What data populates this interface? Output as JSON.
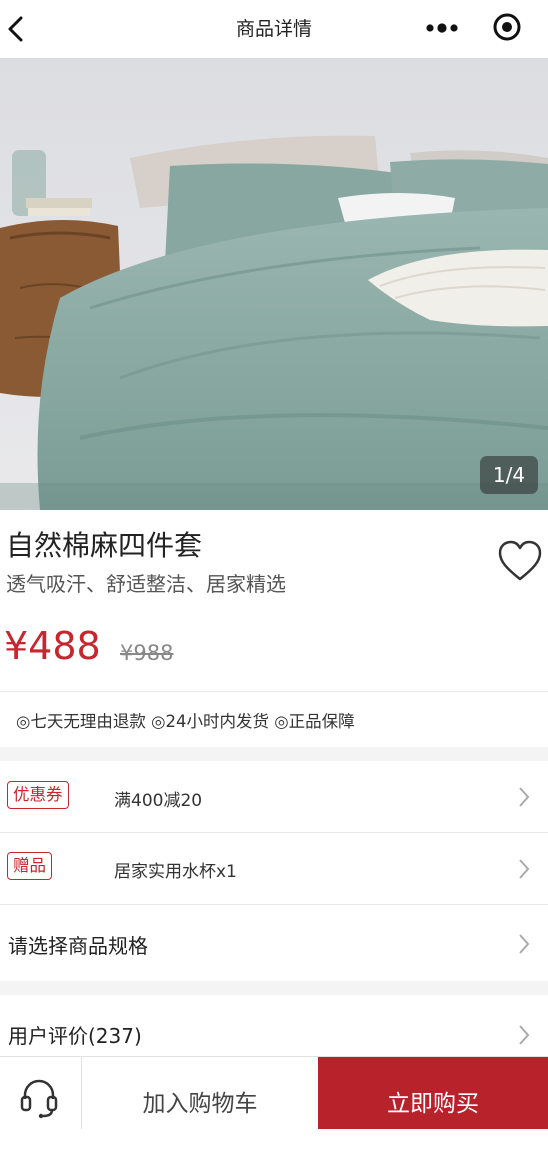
{
  "header": {
    "title": "商品详情",
    "icons": [
      "back-icon",
      "more-icon",
      "target-icon"
    ]
  },
  "gallery": {
    "pager": "1/4",
    "current": 1,
    "total": 4
  },
  "product": {
    "name": "自然棉麻四件套",
    "subtitle": "透气吸汗、舒适整洁、居家精选",
    "price": "¥488",
    "original_price": "¥988"
  },
  "guarantees": "◎七天无理由退款 ◎24小时内发货 ◎正品保障",
  "promotions": [
    {
      "tag": "优惠券",
      "text": "满400减20"
    },
    {
      "tag": "赠品",
      "text": "居家实用水杯x1"
    }
  ],
  "spec": {
    "label": "请选择商品规格"
  },
  "reviews": {
    "label": "用户评价(237)"
  },
  "bottom_bar": {
    "add_to_cart": "加入购物车",
    "buy_now": "立即购买"
  },
  "colors": {
    "accent": "#c8262f",
    "buy_bg": "#b8222a",
    "bedding": "#8aa8a1"
  }
}
